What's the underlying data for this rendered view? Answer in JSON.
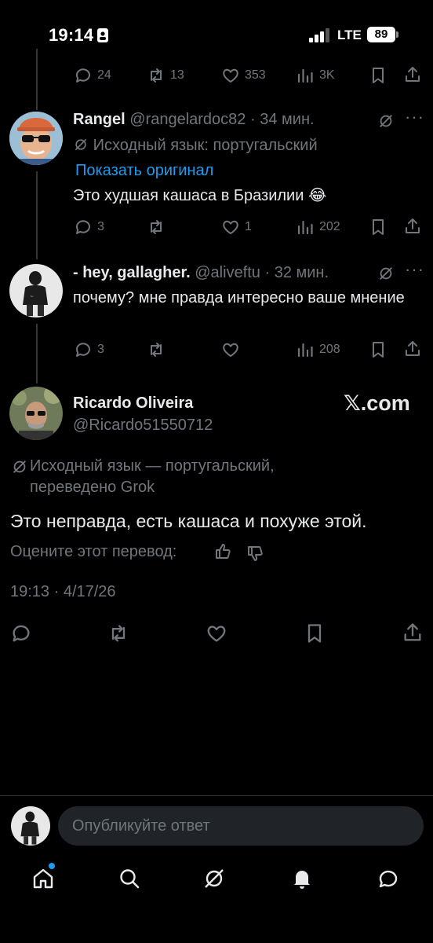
{
  "status_bar": {
    "time": "19:14",
    "network": "LTE",
    "battery": "89"
  },
  "thread_top": {
    "replies": "24",
    "reposts": "13",
    "likes": "353",
    "views": "3K"
  },
  "reply1": {
    "name": "Rangel",
    "handle": "@rangelardoc82",
    "time": "· 34 мин.",
    "lang_note": "Исходный язык: португальский",
    "show_original": "Показать оригинал",
    "text": "Это худшая кашаса в Бразилии 😂",
    "replies": "3",
    "reposts": "",
    "likes": "1",
    "views": "202"
  },
  "reply2": {
    "name": "- hey, gallagher.",
    "handle": "@aliveftu",
    "time": "· 32 мин.",
    "text": "почему? мне правда интересно ваше мнение",
    "replies": "3",
    "reposts": "",
    "likes": "",
    "views": "208"
  },
  "main_tweet": {
    "name": "Ricardo Oliveira",
    "handle": "@Ricardo51550712",
    "watermark": "𝕏.com",
    "lang_note": "Исходный язык — португальский, переведено Grok",
    "text": "Это неправда, есть кашаса и похуже этой.",
    "rate_prompt": "Оцените этот перевод:",
    "timestamp": "19:13 · 4/17/26"
  },
  "reply_box": {
    "placeholder": "Опубликуйте ответ"
  },
  "colors": {
    "background": "#000000",
    "text": "#e7e9ea",
    "muted": "#71767b",
    "link": "#1d9bf0",
    "notification_dot": "#1d9bf0"
  }
}
